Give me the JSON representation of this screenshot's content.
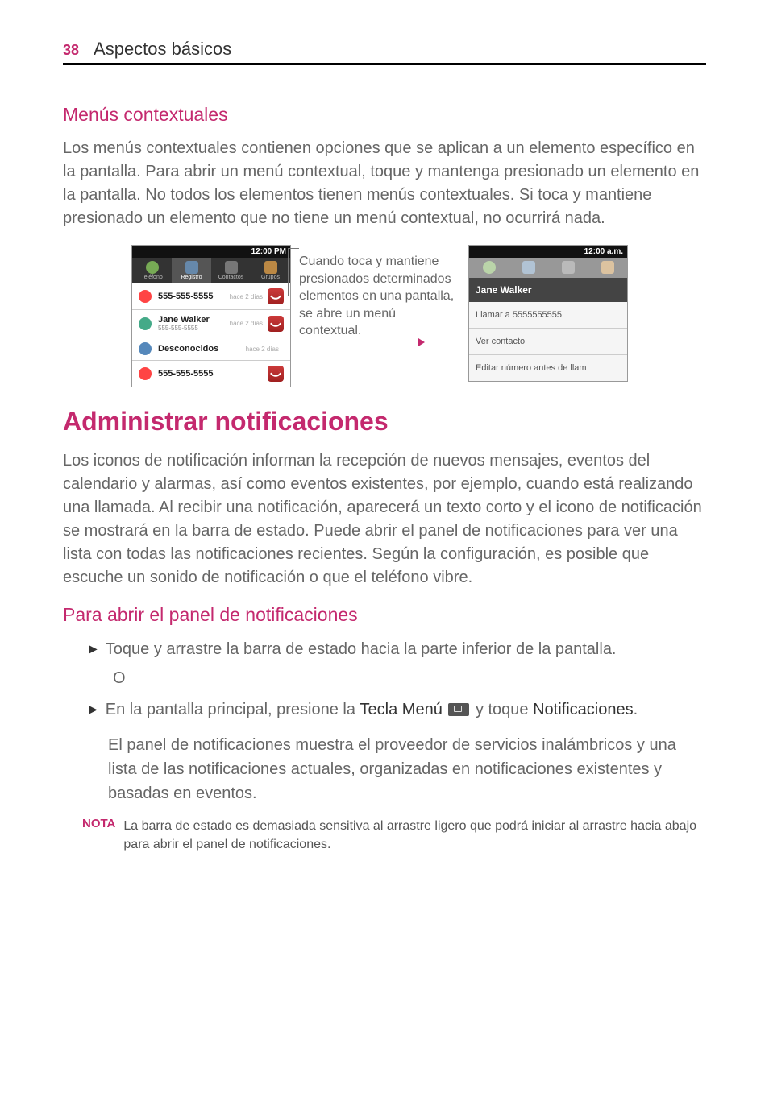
{
  "page": {
    "number": "38",
    "chapter": "Aspectos básicos"
  },
  "sections": {
    "contextual_title": "Menús contextuales",
    "contextual_body": "Los menús contextuales contienen opciones que se aplican a un elemento específico en la pantalla. Para abrir un menú contextual, toque y mantenga presionado un elemento en la pantalla. No todos los elementos tienen menús contextuales. Si toca y mantiene presionado un elemento que no tiene un menú contextual, no ocurrirá nada.",
    "figure_caption": "Cuando toca y mantiene presionados determinados elementos en una pantalla, se abre un menú contextual.",
    "shot1": {
      "time": "12:00 PM",
      "tabs": [
        "Teléfono",
        "Registro",
        "Contactos",
        "Grupos"
      ],
      "rows": [
        {
          "title": "555-555-5555",
          "sub": "",
          "meta": "hace 2 días",
          "type": "missed"
        },
        {
          "title": "Jane Walker",
          "sub": "555-555-5555",
          "meta": "hace 2 días",
          "type": "out"
        },
        {
          "title": "Desconocidos",
          "sub": "",
          "meta": "hace 2 días",
          "type": "in"
        },
        {
          "title": "555-555-5555",
          "sub": "",
          "meta": "",
          "type": "missed"
        }
      ]
    },
    "shot2": {
      "time": "12:00 a.m.",
      "header": "Jane Walker",
      "items": [
        "Llamar a 5555555555",
        "Ver contacto",
        "Editar número antes de llam"
      ]
    },
    "admin_title": "Administrar notificaciones",
    "admin_body": "Los iconos de notificación informan la recepción de nuevos mensajes, eventos del calendario y alarmas, así como eventos existentes, por ejemplo, cuando está realizando una llamada. Al recibir una notificación, aparecerá un texto corto y el icono de notificación se mostrará en la barra de estado. Puede abrir el panel de notificaciones para ver una lista con todas las notificaciones recientes. Según la configuración, es posible que escuche un sonido de notificación o que el teléfono vibre.",
    "open_panel_title": "Para abrir el panel de notificaciones",
    "bullet1": "Toque y arrastre la barra de estado hacia la parte inferior de la pantalla.",
    "or": "O",
    "bullet2_a": "En la pantalla principal, presione la ",
    "bullet2_bold1": "Tecla Menú",
    "bullet2_b": " y toque ",
    "bullet2_bold2": "Notificaciones",
    "bullet2_c": ".",
    "panel_desc": "El panel de notificaciones muestra el proveedor de servicios inalámbricos y una lista de las notificaciones actuales, organizadas en notificaciones existentes y basadas en eventos.",
    "note_label": "NOTA",
    "note_text": "La barra de estado es demasiada sensitiva al arrastre ligero que podrá iniciar al arrastre hacia abajo para abrir el panel de notificaciones."
  }
}
